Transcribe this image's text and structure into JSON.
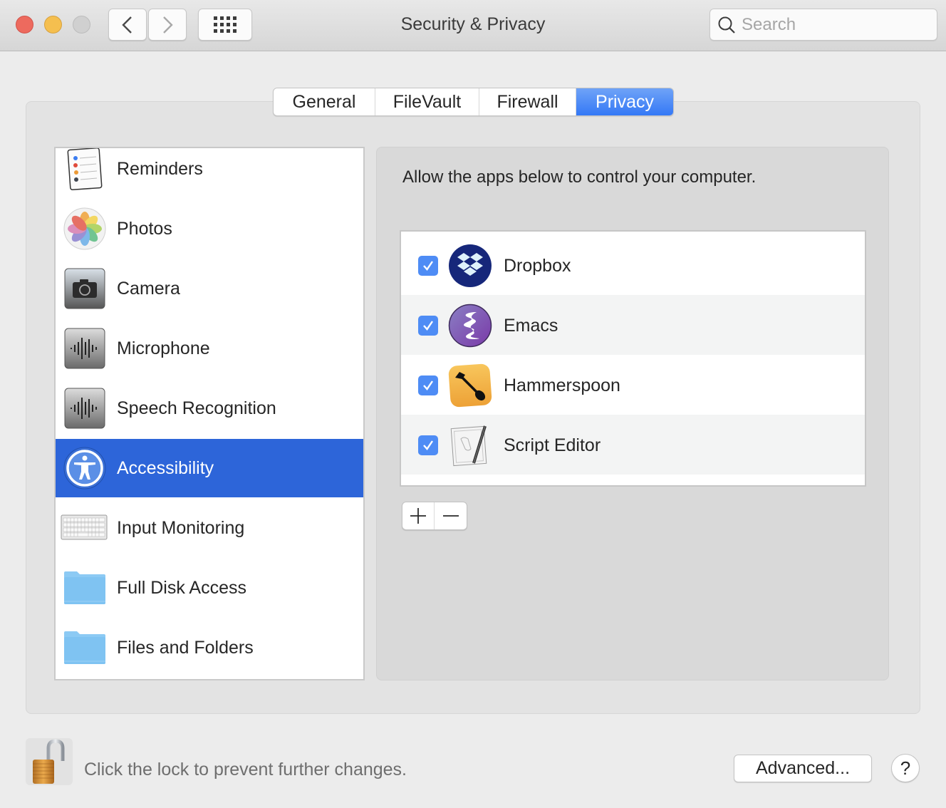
{
  "window": {
    "title": "Security & Privacy",
    "search": {
      "placeholder": "Search",
      "value": ""
    }
  },
  "tabs": [
    {
      "label": "General",
      "active": false
    },
    {
      "label": "FileVault",
      "active": false
    },
    {
      "label": "Firewall",
      "active": false
    },
    {
      "label": "Privacy",
      "active": true
    }
  ],
  "sidebar": {
    "items": [
      {
        "label": "Reminders",
        "icon": "reminders-icon"
      },
      {
        "label": "Photos",
        "icon": "photos-icon"
      },
      {
        "label": "Camera",
        "icon": "camera-icon"
      },
      {
        "label": "Microphone",
        "icon": "microphone-icon"
      },
      {
        "label": "Speech Recognition",
        "icon": "speech-recognition-icon"
      },
      {
        "label": "Accessibility",
        "icon": "accessibility-icon",
        "selected": true
      },
      {
        "label": "Input Monitoring",
        "icon": "keyboard-icon"
      },
      {
        "label": "Full Disk Access",
        "icon": "folder-icon"
      },
      {
        "label": "Files and Folders",
        "icon": "folder-icon"
      }
    ]
  },
  "panel": {
    "description": "Allow the apps below to control your computer.",
    "apps": [
      {
        "name": "Dropbox",
        "checked": true,
        "icon": "dropbox-icon"
      },
      {
        "name": "Emacs",
        "checked": true,
        "icon": "emacs-icon"
      },
      {
        "name": "Hammerspoon",
        "checked": true,
        "icon": "hammerspoon-icon"
      },
      {
        "name": "Script Editor",
        "checked": true,
        "icon": "script-editor-icon"
      }
    ],
    "add_label": "+",
    "remove_label": "−"
  },
  "footer": {
    "lock_text": "Click the lock to prevent further changes.",
    "advanced_label": "Advanced...",
    "help_label": "?"
  },
  "colors": {
    "accent": "#3478f6",
    "selection": "#2d65d9",
    "checkbox": "#4e8cf5"
  }
}
